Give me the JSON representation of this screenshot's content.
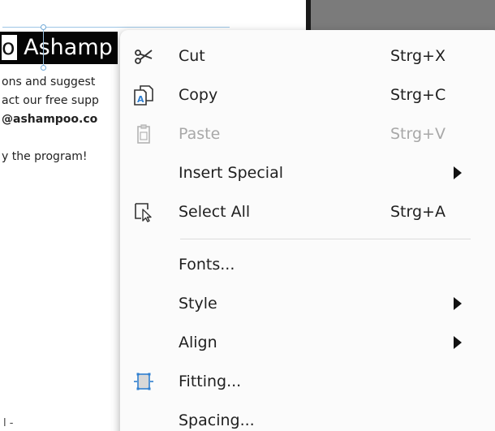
{
  "document": {
    "headline_prefix": "o",
    "headline_text": "Ashamp",
    "body_lines": [
      "ons and suggest",
      "act our free supp",
      "@ashampoo.co",
      "y the program!"
    ],
    "bottom_fragment": "l -"
  },
  "context_menu": {
    "items": [
      {
        "label": "Cut",
        "shortcut": "Strg+X",
        "icon": "scissors-icon",
        "enabled": true
      },
      {
        "label": "Copy",
        "shortcut": "Strg+C",
        "icon": "copy-icon",
        "enabled": true
      },
      {
        "label": "Paste",
        "shortcut": "Strg+V",
        "icon": "paste-icon",
        "enabled": false
      },
      {
        "label": "Insert Special",
        "shortcut": "",
        "icon": "",
        "submenu": true,
        "enabled": true
      },
      {
        "label": "Select All",
        "shortcut": "Strg+A",
        "icon": "select-all-icon",
        "enabled": true
      },
      {
        "label": "Fonts...",
        "shortcut": "",
        "icon": "",
        "enabled": true
      },
      {
        "label": "Style",
        "shortcut": "",
        "icon": "",
        "submenu": true,
        "enabled": true
      },
      {
        "label": "Align",
        "shortcut": "",
        "icon": "",
        "submenu": true,
        "enabled": true
      },
      {
        "label": "Fitting...",
        "shortcut": "",
        "icon": "fitting-icon",
        "enabled": true
      },
      {
        "label": "Spacing...",
        "shortcut": "",
        "icon": "",
        "enabled": true
      }
    ]
  },
  "colors": {
    "menu_background": "#fbfbfb",
    "text": "#1f1f1f",
    "disabled_text": "#a8a8a8",
    "icon_accent": "#2f7fd0",
    "headline_background": "#050505"
  }
}
